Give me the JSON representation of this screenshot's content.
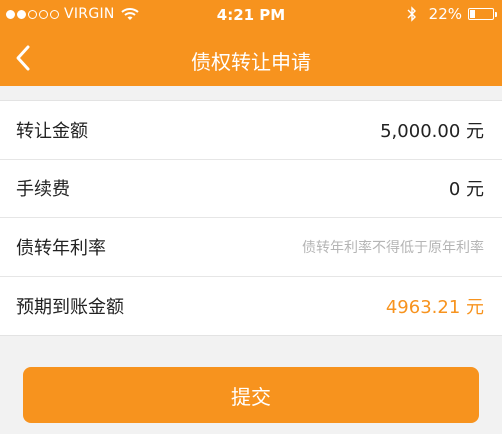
{
  "status_bar": {
    "carrier": "VIRGIN",
    "time": "4:21 PM",
    "battery_percent": "22%",
    "battery_level": 0.22,
    "signal_bars": 2,
    "icons": [
      "signal-dots-icon",
      "wifi-icon",
      "bluetooth-icon",
      "battery-icon"
    ]
  },
  "nav": {
    "title": "债权转让申请",
    "back_icon": "chevron-left-icon"
  },
  "rows": [
    {
      "label": "转让金额",
      "value": "5,000.00 元"
    },
    {
      "label": "手续费",
      "value": "0 元"
    },
    {
      "label": "债转年利率",
      "placeholder": "债转年利率不得低于原年利率"
    },
    {
      "label": "预期到账金额",
      "value": "4963.21 元"
    }
  ],
  "submit_label": "提交",
  "colors": {
    "accent": "#f7931e",
    "background": "#f2f2f2",
    "placeholder": "#b5b5b5"
  }
}
